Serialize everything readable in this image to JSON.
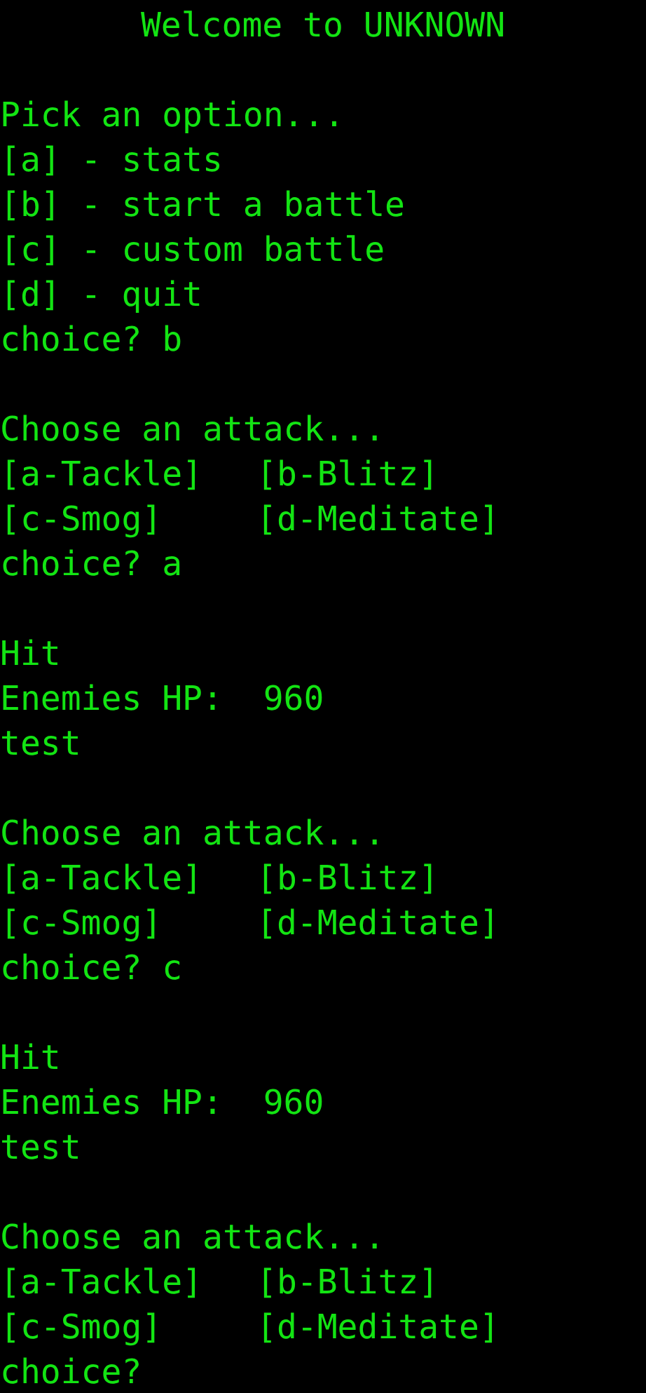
{
  "terminal": {
    "lines": [
      {
        "kind": "title",
        "text": "Welcome to UNKNOWN"
      },
      {
        "kind": "blank"
      },
      {
        "kind": "text",
        "text": "Pick an option..."
      },
      {
        "kind": "text",
        "text": "[a] - stats"
      },
      {
        "kind": "text",
        "text": "[b] - start a battle"
      },
      {
        "kind": "text",
        "text": "[c] - custom battle"
      },
      {
        "kind": "text",
        "text": "[d] - quit"
      },
      {
        "kind": "text",
        "text": "choice? b"
      },
      {
        "kind": "blank"
      },
      {
        "kind": "text",
        "text": "Choose an attack..."
      },
      {
        "kind": "pair",
        "cells": [
          "[a-Tackle]",
          "[b-Blitz]"
        ]
      },
      {
        "kind": "pair",
        "cells": [
          "[c-Smog]",
          "[d-Meditate]"
        ]
      },
      {
        "kind": "text",
        "text": "choice? a"
      },
      {
        "kind": "blank"
      },
      {
        "kind": "text",
        "text": "Hit"
      },
      {
        "kind": "text",
        "text": "Enemies HP:  960"
      },
      {
        "kind": "text",
        "text": "test"
      },
      {
        "kind": "blank"
      },
      {
        "kind": "text",
        "text": "Choose an attack..."
      },
      {
        "kind": "pair",
        "cells": [
          "[a-Tackle]",
          "[b-Blitz]"
        ]
      },
      {
        "kind": "pair",
        "cells": [
          "[c-Smog]",
          "[d-Meditate]"
        ]
      },
      {
        "kind": "text",
        "text": "choice? c"
      },
      {
        "kind": "blank"
      },
      {
        "kind": "text",
        "text": "Hit"
      },
      {
        "kind": "text",
        "text": "Enemies HP:  960"
      },
      {
        "kind": "text",
        "text": "test"
      },
      {
        "kind": "blank"
      },
      {
        "kind": "text",
        "text": "Choose an attack..."
      },
      {
        "kind": "pair",
        "cells": [
          "[a-Tackle]",
          "[b-Blitz]"
        ]
      },
      {
        "kind": "pair",
        "cells": [
          "[c-Smog]",
          "[d-Meditate]"
        ]
      },
      {
        "kind": "text",
        "text": "choice?"
      }
    ]
  }
}
